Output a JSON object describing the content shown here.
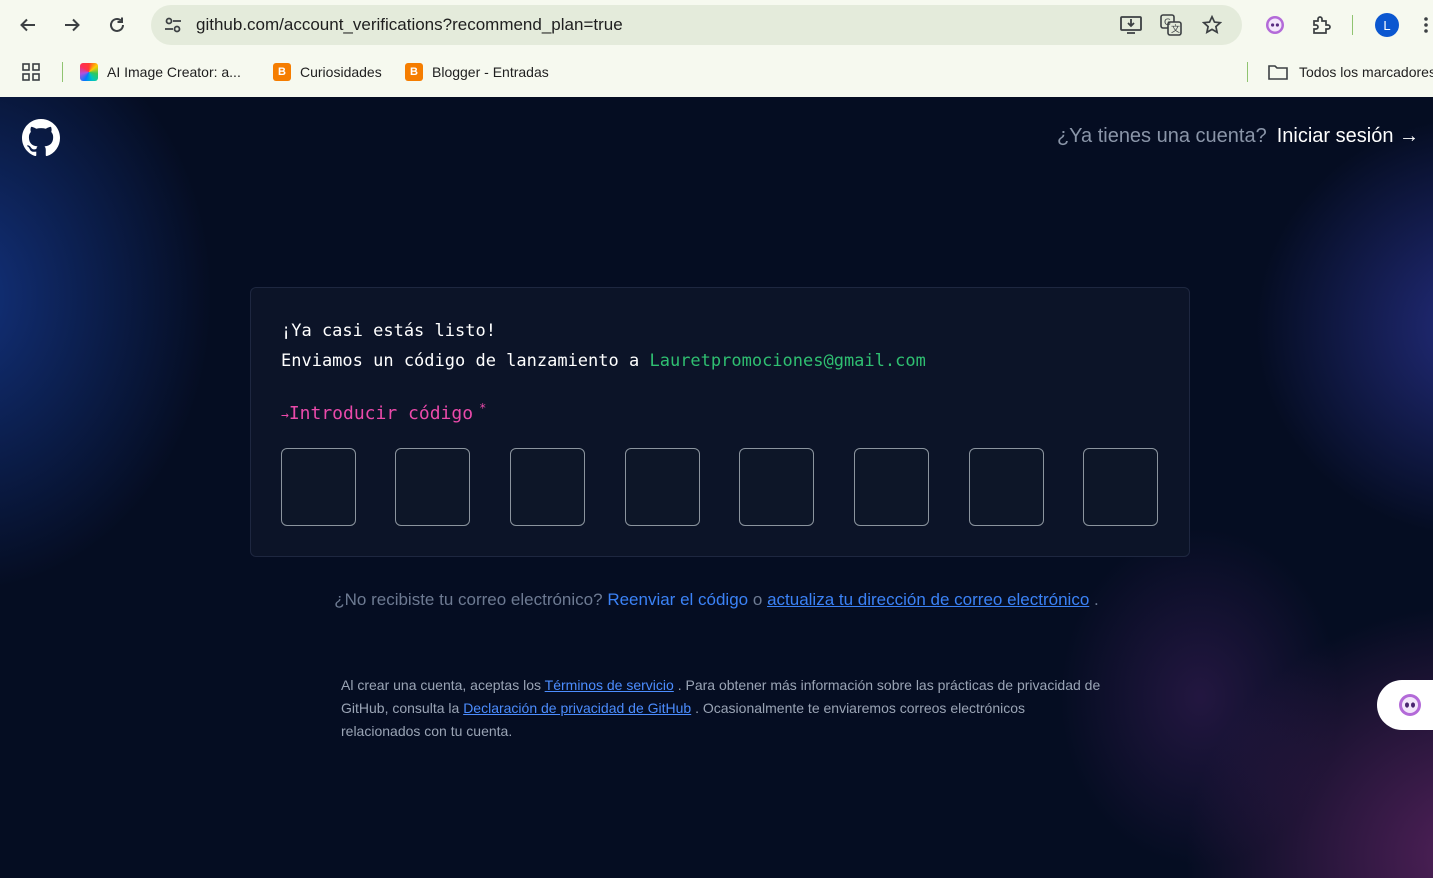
{
  "browser": {
    "url": "github.com/account_verifications?recommend_plan=true",
    "profile_initial": "L",
    "bookmarks": [
      {
        "label": "AI Image Creator: a...",
        "icon": "ai-image-creator-icon"
      },
      {
        "label": "Curiosidades",
        "icon": "blogger-icon"
      },
      {
        "label": "Blogger - Entradas",
        "icon": "blogger-icon"
      }
    ],
    "all_bookmarks_label": "Todos los marcadores"
  },
  "header": {
    "question": "¿Ya tienes una cuenta?",
    "signin": "Iniciar sesión →"
  },
  "card": {
    "title": "¡Ya casi estás listo!",
    "sent_text": "Enviamos un código de lanzamiento a",
    "email": "Lauretpromociones@gmail.com",
    "code_arrow": "→",
    "code_label": "Introducir código",
    "required_mark": "*",
    "code_digits": [
      "",
      "",
      "",
      "",
      "",
      "",
      "",
      ""
    ]
  },
  "resend": {
    "question": "¿No recibiste tu correo electrónico?",
    "resend_link": "Reenviar el código",
    "or": "o",
    "update_link": "actualiza tu dirección de correo electrónico",
    "period": "."
  },
  "terms": {
    "part1": "Al crear una cuenta, aceptas los",
    "terms_link": "Términos de servicio",
    "part2": ". Para obtener más información sobre las prácticas de privacidad de GitHub, consulta la",
    "privacy_link": "Declaración de privacidad de GitHub",
    "part3": ". Ocasionalmente te enviaremos correos electrónicos relacionados con tu cuenta."
  },
  "colors": {
    "accent_pink": "#ea4aaa",
    "email_green": "#2fbf71",
    "link_blue": "#3b82f6"
  }
}
